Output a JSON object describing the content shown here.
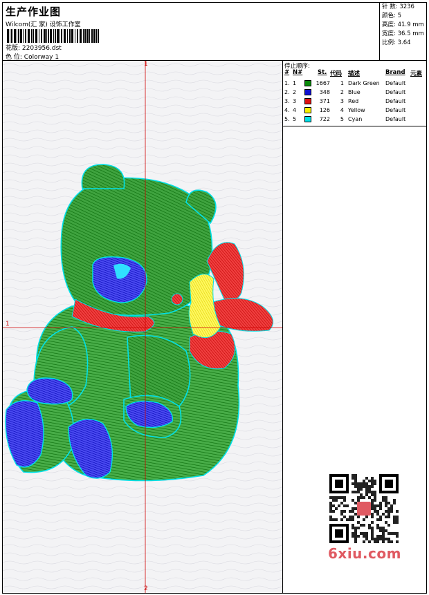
{
  "header": {
    "title": "生产作业图",
    "company": "Wilcom(汇 家) 设饰工作室",
    "design_label": "花版:",
    "design_value": "2203956.dst",
    "colorway_label": "色 位:",
    "colorway_value": "Colorway 1"
  },
  "stats": [
    {
      "label": "针 数:",
      "value": "3236"
    },
    {
      "label": "颜色:",
      "value": "5"
    },
    {
      "label": "高度:",
      "value": "41.9 mm"
    },
    {
      "label": "宽度:",
      "value": "36.5 mm"
    },
    {
      "label": "比例:",
      "value": "3.64"
    }
  ],
  "axes": {
    "top_label": "1",
    "left_label": "1",
    "bottom_label": "2"
  },
  "stop_sequence": {
    "title": "停止顺序:",
    "headers": {
      "idx": "#",
      "num": "N#",
      "stitches": "St.",
      "code": "代码",
      "desc": "描述",
      "brand": "Brand",
      "elem": "元素"
    },
    "rows": [
      {
        "idx": "1.",
        "num": "1",
        "color": "#0a8a0a",
        "stitches": "1667",
        "code": "1",
        "desc": "Dark Green",
        "brand": "Default"
      },
      {
        "idx": "2.",
        "num": "2",
        "color": "#1010d0",
        "stitches": "348",
        "code": "2",
        "desc": "Blue",
        "brand": "Default"
      },
      {
        "idx": "3.",
        "num": "3",
        "color": "#e01010",
        "stitches": "371",
        "code": "3",
        "desc": "Red",
        "brand": "Default"
      },
      {
        "idx": "4.",
        "num": "4",
        "color": "#f5f000",
        "stitches": "126",
        "code": "4",
        "desc": "Yellow",
        "brand": "Default"
      },
      {
        "idx": "5.",
        "num": "5",
        "color": "#00e0e8",
        "stitches": "722",
        "code": "5",
        "desc": "Cyan",
        "brand": "Default"
      }
    ]
  },
  "watermark": "6xiu.com",
  "qr_badge": "汉化\n刺绣"
}
